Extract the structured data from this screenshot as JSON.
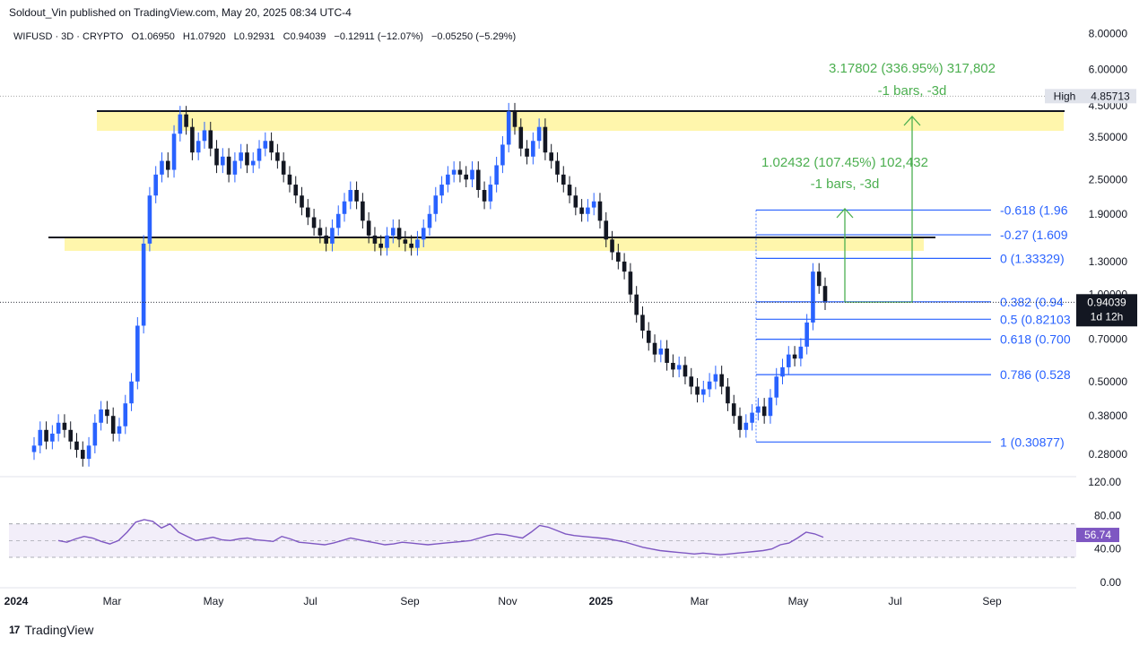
{
  "header": {
    "publisher": "Soldout_Vin published on TradingView.com, May 20, 2025 08:34 UTC-4",
    "symbol": "WIFUSD · 3D · CRYPTO",
    "open": "O1.06950",
    "high": "H1.07920",
    "low": "L0.92931",
    "close": "C0.94039",
    "change": "−0.12911 (−12.07%)",
    "change2": "−0.05250 (−5.29%)"
  },
  "footer": {
    "brand": "TradingView",
    "logo": "17"
  },
  "colors": {
    "up": "#2962ff",
    "down": "#131722",
    "fib": "#2962ff",
    "measure": "#4caf50",
    "zone": "#fff59d",
    "rsi": "#7e57c2"
  },
  "chart_data": {
    "type": "candlestick",
    "y_scale": "log",
    "price_ticks": [
      "8.00000",
      "6.00000",
      "4.50000",
      "3.50000",
      "2.50000",
      "1.90000",
      "1.30000",
      "1.00000",
      "0.70000",
      "0.50000",
      "0.38000",
      "0.28000"
    ],
    "rsi_ticks": [
      "120.00",
      "80.00",
      "40.00",
      "0.00"
    ],
    "x_ticks": [
      "2024",
      "Mar",
      "May",
      "Jul",
      "Sep",
      "Nov",
      "2025",
      "Mar",
      "May",
      "Jul",
      "Sep"
    ],
    "high_label": "High",
    "high_value": "4.85713",
    "last_price": "0.94039",
    "countdown": "1d 12h",
    "rsi_value": "56.74",
    "fib_levels": [
      {
        "label": "-0.618 (1.96"
      },
      {
        "label": "-0.27 (1.609"
      },
      {
        "label": "0 (1.33329)"
      },
      {
        "label": "0.382 (0.94"
      },
      {
        "label": "0.5 (0.82103"
      },
      {
        "label": "0.618 (0.700"
      },
      {
        "label": "0.786 (0.528"
      },
      {
        "label": "1 (0.30877)"
      }
    ],
    "measure_1": {
      "line1": "1.02432 (107.45%) 102,432",
      "line2": "-1 bars, -3d"
    },
    "measure_2": {
      "line1": "3.17802 (336.95%) 317,802",
      "line2": "-1 bars, -3d"
    },
    "closes": [
      0.3,
      0.34,
      0.31,
      0.33,
      0.36,
      0.34,
      0.31,
      0.29,
      0.27,
      0.3,
      0.36,
      0.4,
      0.38,
      0.33,
      0.35,
      0.42,
      0.5,
      0.78,
      1.5,
      2.2,
      2.6,
      2.9,
      2.7,
      3.6,
      4.2,
      3.8,
      3.1,
      3.4,
      3.7,
      3.2,
      2.8,
      3.0,
      2.6,
      2.9,
      3.1,
      2.8,
      2.9,
      3.2,
      3.4,
      3.1,
      2.9,
      2.6,
      2.4,
      2.2,
      2.0,
      1.85,
      1.7,
      1.6,
      1.5,
      1.7,
      1.9,
      2.1,
      2.3,
      2.1,
      1.8,
      1.6,
      1.5,
      1.45,
      1.6,
      1.7,
      1.55,
      1.5,
      1.45,
      1.55,
      1.7,
      1.9,
      2.2,
      2.4,
      2.6,
      2.7,
      2.6,
      2.5,
      2.7,
      2.3,
      2.1,
      2.4,
      2.8,
      3.3,
      4.3,
      3.8,
      3.2,
      3.0,
      3.4,
      3.8,
      3.1,
      2.9,
      2.6,
      2.4,
      2.2,
      2.0,
      1.9,
      2.0,
      2.1,
      1.8,
      1.55,
      1.4,
      1.3,
      1.2,
      1.0,
      0.85,
      0.75,
      0.68,
      0.62,
      0.65,
      0.58,
      0.55,
      0.57,
      0.52,
      0.48,
      0.45,
      0.47,
      0.5,
      0.53,
      0.48,
      0.42,
      0.38,
      0.34,
      0.36,
      0.39,
      0.41,
      0.38,
      0.44,
      0.52,
      0.56,
      0.62,
      0.6,
      0.66,
      0.8,
      1.2,
      1.07,
      0.94
    ],
    "rsi": [
      50,
      48,
      52,
      55,
      53,
      49,
      46,
      50,
      60,
      72,
      75,
      73,
      65,
      70,
      60,
      55,
      50,
      52,
      54,
      51,
      50,
      52,
      53,
      51,
      50,
      49,
      55,
      52,
      48,
      47,
      46,
      45,
      47,
      50,
      53,
      51,
      49,
      47,
      45,
      46,
      48,
      47,
      46,
      45,
      46,
      47,
      48,
      49,
      50,
      53,
      56,
      58,
      57,
      55,
      53,
      60,
      68,
      66,
      62,
      58,
      56,
      55,
      54,
      53,
      52,
      50,
      48,
      45,
      42,
      40,
      38,
      37,
      36,
      35,
      34,
      35,
      34,
      33,
      34,
      35,
      36,
      37,
      38,
      40,
      45,
      47,
      53,
      60,
      58,
      54
    ]
  }
}
